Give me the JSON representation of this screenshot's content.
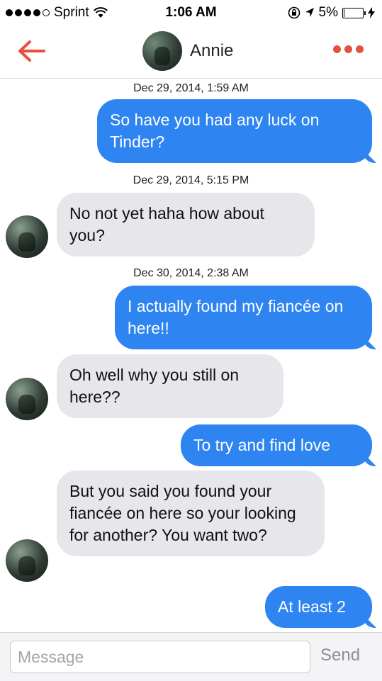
{
  "status_bar": {
    "carrier": "Sprint",
    "time": "1:06 AM",
    "battery": "5%",
    "battery_level": 0.05
  },
  "nav": {
    "back_icon": "back-arrow-icon",
    "contact_name": "Annie",
    "more_icon": "more-dots-icon",
    "accent": "#e5503f"
  },
  "colors": {
    "sent": "#2e84f0",
    "received": "#e6e6eb"
  },
  "thread": {
    "ts1": "Dec 29, 2014, 1:59 AM",
    "m1": "So have you had any luck on Tinder?",
    "ts2": "Dec 29, 2014, 5:15 PM",
    "m2": "No not yet haha how about you?",
    "ts3": "Dec 30, 2014, 2:38 AM",
    "m3": "I actually found my fiancée on here!!",
    "m4": "Oh well why you still on here??",
    "m5": "To try and find love",
    "m6": "But you said you found your fiancée on here so your looking for another? You want two?",
    "m7": "At least 2"
  },
  "composer": {
    "placeholder": "Message",
    "send_label": "Send"
  }
}
